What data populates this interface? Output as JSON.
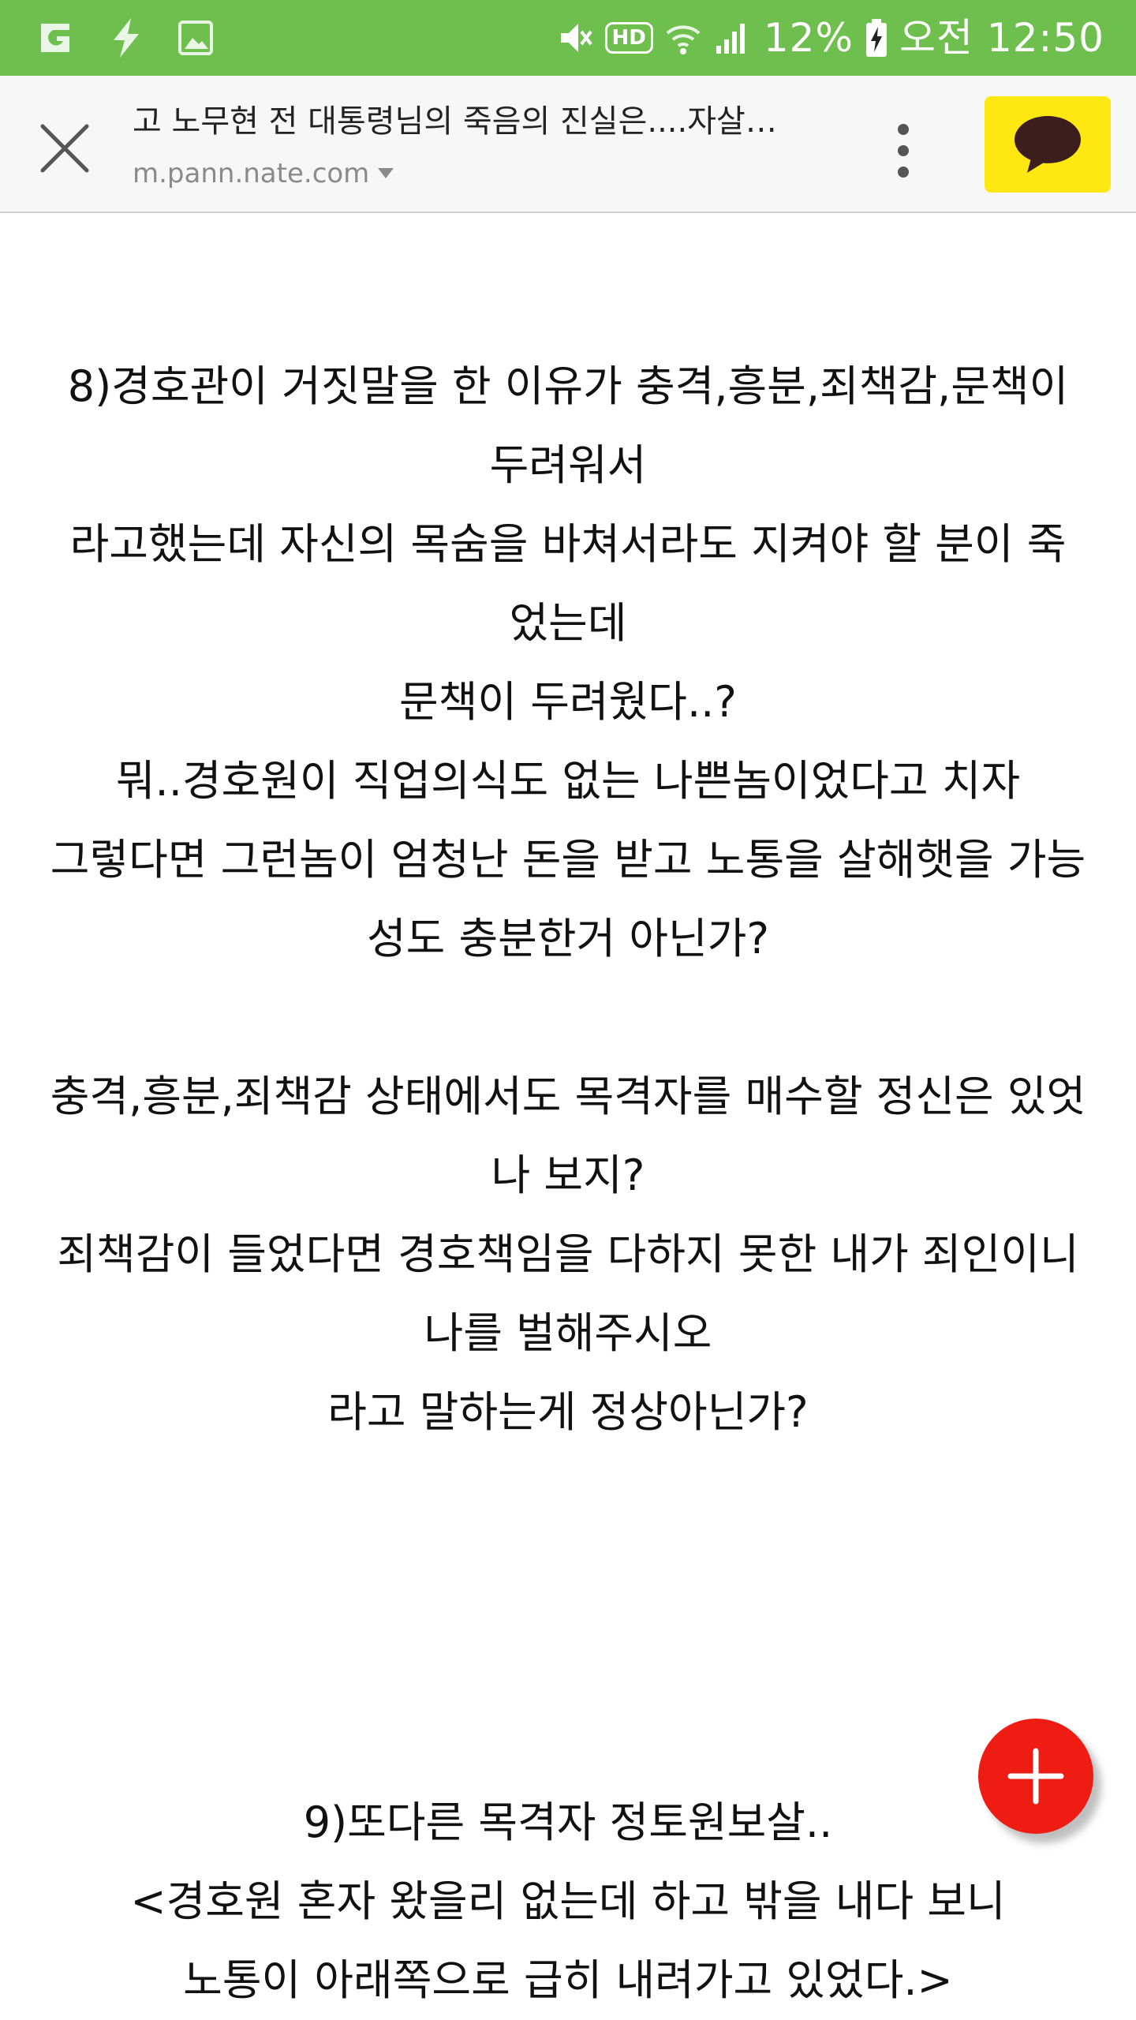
{
  "status_bar": {
    "battery": "12%",
    "time": "오전 12:50",
    "hd_label": "HD",
    "icons": [
      "g-icon",
      "lightning-icon",
      "image-icon",
      "mute-icon",
      "wifi-icon",
      "signal-icon",
      "battery-charging-icon"
    ]
  },
  "browser": {
    "title": "고 노무현 전 대통령님의 죽음의 진실은....자살이...",
    "url": "m.pann.nate.com",
    "accent_color": "#ffe812"
  },
  "article": {
    "section8": [
      "8)경호관이 거짓말을 한 이유가 충격,흥분,죄책감,문책이",
      "두려워서",
      "라고했는데 자신의 목숨을 바쳐서라도 지켜야 할 분이 죽",
      "었는데",
      "문책이 두려웠다..?",
      "뭐..경호원이 직업의식도 없는 나쁜놈이었다고 치자",
      "그렇다면 그런놈이 엄청난 돈을 받고 노통을 살해햇을 가능",
      "성도 충분한거 아닌가?"
    ],
    "section8b": [
      "충격,흥분,죄책감 상태에서도 목격자를 매수할 정신은 있엇",
      "나 보지?",
      "죄책감이 들었다면 경호책임을 다하지 못한 내가 죄인이니",
      "나를 벌해주시오",
      "라고 말하는게 정상아닌가?"
    ],
    "section9": [
      "9)또다른 목격자 정토원보살..",
      "<경호원 혼자 왔을리 없는데 하고 밖을 내다 보니",
      "노통이 아래쪽으로 급히 내려가고 있었다.>"
    ]
  },
  "colors": {
    "status_bar": "#6fbf4f",
    "fab": "#ee1c13"
  }
}
